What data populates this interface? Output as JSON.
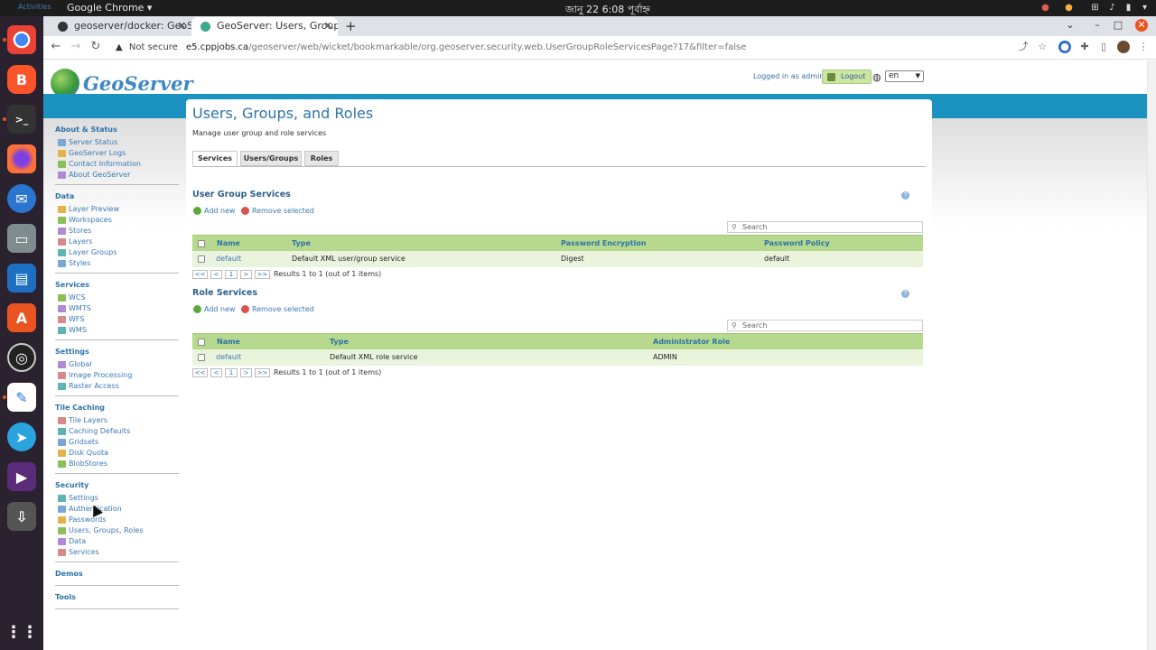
{
  "system": {
    "activities": "Activities",
    "app_menu": "Google Chrome ▾",
    "clock": "জানু 22  6:08 পূর্বাহ্ন"
  },
  "browser": {
    "tabs": [
      {
        "label": "geoserver/docker: GeoSe",
        "active": false
      },
      {
        "label": "GeoServer: Users, Groups",
        "active": true
      }
    ],
    "new_tab": "+",
    "not_secure": "Not secure",
    "url_host": "e5.cppjobs.ca",
    "url_path": "/geoserver/web/wicket/bookmarkable/org.geoserver.security.web.UserGroupRoleServicesPage?17&filter=false"
  },
  "header": {
    "logo_text": "GeoServer",
    "logged_in": "Logged in as admin.",
    "logout": "Logout",
    "language": "en"
  },
  "sidebar": [
    {
      "title": "About & Status",
      "items": [
        "Server Status",
        "GeoServer Logs",
        "Contact Information",
        "About GeoServer"
      ]
    },
    {
      "title": "Data",
      "items": [
        "Layer Preview",
        "Workspaces",
        "Stores",
        "Layers",
        "Layer Groups",
        "Styles"
      ]
    },
    {
      "title": "Services",
      "items": [
        "WCS",
        "WMTS",
        "WFS",
        "WMS"
      ]
    },
    {
      "title": "Settings",
      "items": [
        "Global",
        "Image Processing",
        "Raster Access"
      ]
    },
    {
      "title": "Tile Caching",
      "items": [
        "Tile Layers",
        "Caching Defaults",
        "Gridsets",
        "Disk Quota",
        "BlobStores"
      ]
    },
    {
      "title": "Security",
      "items": [
        "Settings",
        "Authentication",
        "Passwords",
        "Users, Groups, Roles",
        "Data",
        "Services"
      ]
    },
    {
      "title": "Demos",
      "items": []
    },
    {
      "title": "Tools",
      "items": []
    }
  ],
  "main": {
    "title": "Users, Groups, and Roles",
    "description": "Manage user group and role services",
    "tabs": [
      "Services",
      "Users/Groups",
      "Roles"
    ],
    "user_group": {
      "title": "User Group Services",
      "add": "Add new",
      "remove": "Remove selected",
      "search_placeholder": "Search",
      "columns": [
        "Name",
        "Type",
        "Password Encryption",
        "Password Policy"
      ],
      "row": [
        "default",
        "Default XML user/group service",
        "Digest",
        "default"
      ],
      "pager": [
        "<<",
        "<",
        "1",
        ">",
        ">>"
      ],
      "results": "Results 1 to 1 (out of 1 items)"
    },
    "role": {
      "title": "Role Services",
      "add": "Add new",
      "remove": "Remove selected",
      "search_placeholder": "Search",
      "columns": [
        "Name",
        "Type",
        "Administrator Role"
      ],
      "row": [
        "default",
        "Default XML role service",
        "ADMIN"
      ],
      "pager": [
        "<<",
        "<",
        "1",
        ">",
        ">>"
      ],
      "results": "Results 1 to 1 (out of 1 items)"
    }
  },
  "colors": {
    "accent": "#1b92bf",
    "link": "#3a79b4",
    "table_header": "#b6d98e",
    "table_row": "#eaf4dd"
  }
}
